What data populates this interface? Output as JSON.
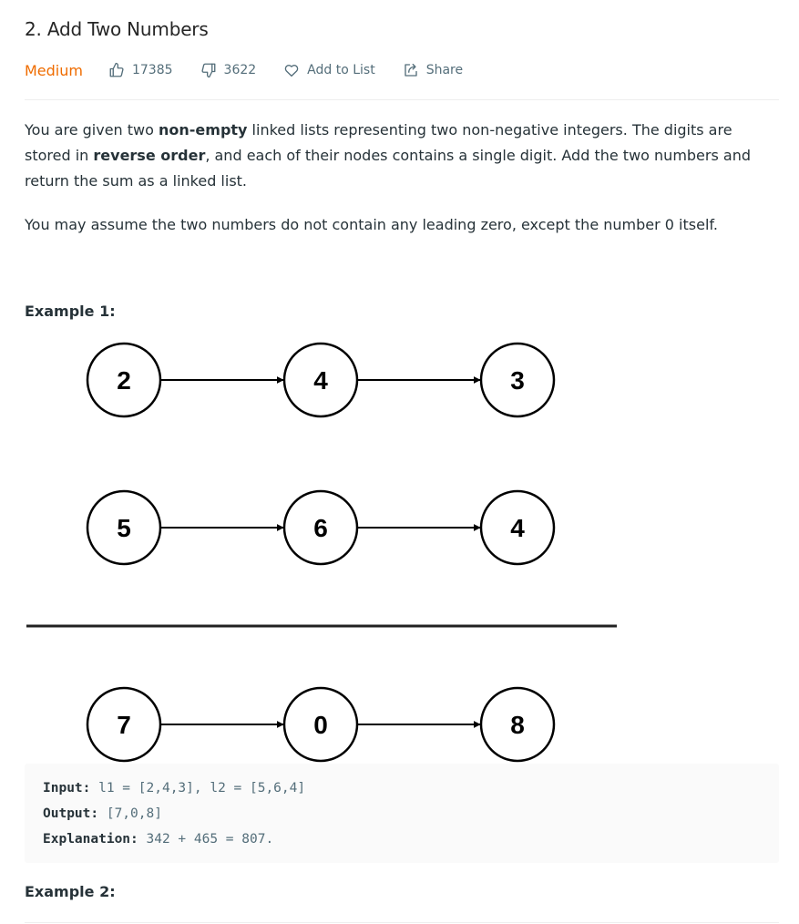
{
  "problem": {
    "title": "2. Add Two Numbers",
    "difficulty": "Medium",
    "likes": "17385",
    "dislikes": "3622",
    "add_to_list": "Add to List",
    "share": "Share"
  },
  "description": {
    "p1_a": "You are given two ",
    "p1_b": "non-empty",
    "p1_c": " linked lists representing two non-negative integers. The digits are stored in ",
    "p1_d": "reverse order",
    "p1_e": ", and each of their nodes contains a single digit. Add the two numbers and return the sum as a linked list.",
    "p2": "You may assume the two numbers do not contain any leading zero, except the number 0 itself."
  },
  "example1": {
    "heading": "Example 1:",
    "diagram": {
      "list1": [
        "2",
        "4",
        "3"
      ],
      "list2": [
        "5",
        "6",
        "4"
      ],
      "result": [
        "7",
        "0",
        "8"
      ]
    },
    "input_key": "Input:",
    "input_val": " l1 = [2,4,3], l2 = [5,6,4]",
    "output_key": "Output:",
    "output_val": " [7,0,8]",
    "explanation_key": "Explanation:",
    "explanation_val": " 342 + 465 = 807."
  },
  "example2": {
    "heading": "Example 2:"
  },
  "colors": {
    "difficulty_medium": "#ef6c00",
    "meta_gray": "#546e7a",
    "code_bg": "#fafafa"
  }
}
